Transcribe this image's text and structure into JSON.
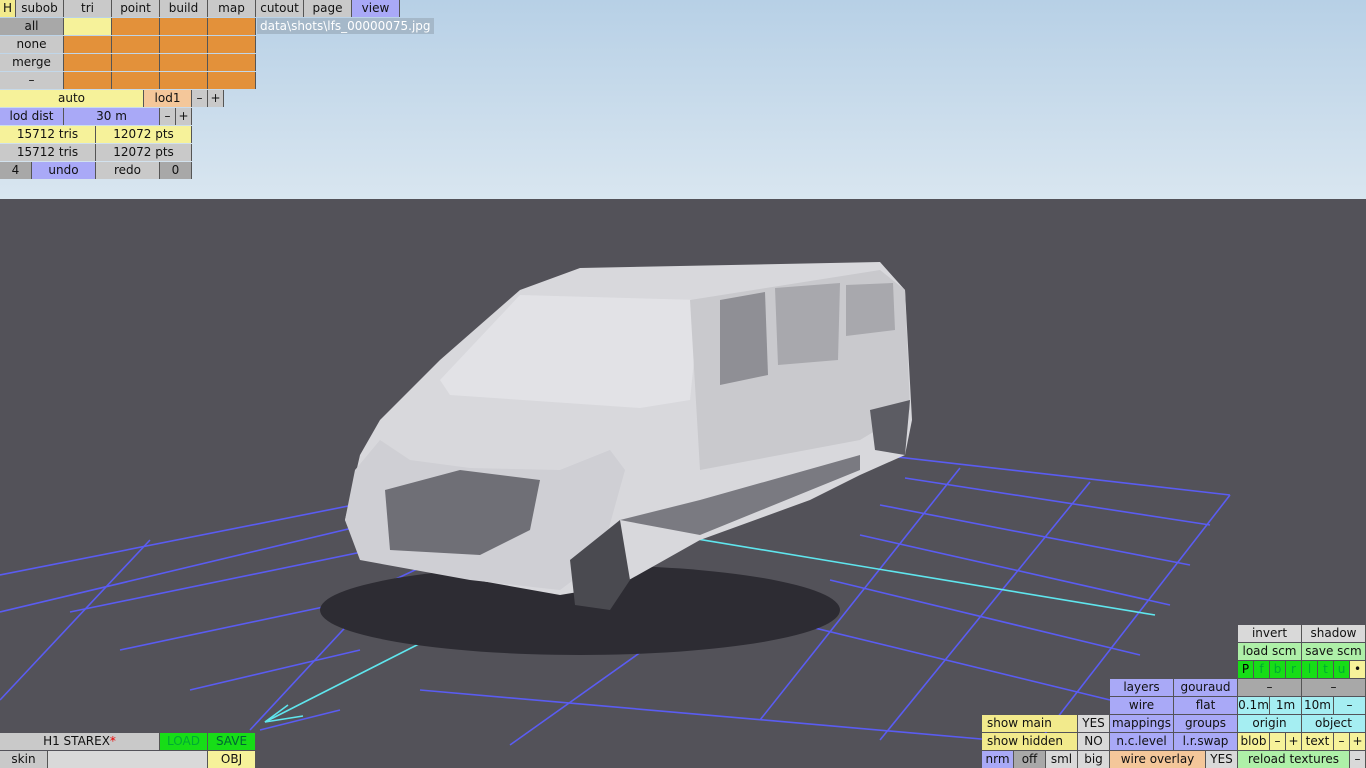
{
  "toolbar": {
    "h": "H",
    "subob": "subob",
    "tri": "tri",
    "point": "point",
    "build": "build",
    "map": "map",
    "cutout": "cutout",
    "page": "page",
    "view": "view"
  },
  "select": {
    "all": "all",
    "none": "none",
    "merge": "merge",
    "dash": "–"
  },
  "file_path": "data\\shots\\lfs_00000075.jpg",
  "lod": {
    "auto": "auto",
    "lod1": "lod1",
    "minus": "–",
    "plus": "+",
    "dist_label": "lod dist",
    "dist_value": "30 m",
    "tris1": "15712 tris",
    "pts1": "12072 pts",
    "tris2": "15712 tris",
    "pts2": "12072 pts"
  },
  "history": {
    "count": "4",
    "undo": "undo",
    "redo": "redo",
    "redo_count": "0"
  },
  "bottom_left": {
    "model_name": "H1 STAREX",
    "modified_mark": "*",
    "load": "LOAD",
    "save": "SAVE",
    "skin": "skin",
    "obj": "OBJ"
  },
  "bottom_right": {
    "invert": "invert",
    "shadow": "shadow",
    "load_scm": "load scm",
    "save_scm": "save scm",
    "view_letters": [
      "P",
      "f",
      "b",
      "r",
      "l",
      "t",
      "u",
      "•"
    ],
    "layers": "layers",
    "gouraud": "gouraud",
    "dash": "–",
    "wire": "wire",
    "flat": "flat",
    "m01": "0.1m",
    "m1": "1m",
    "m10": "10m",
    "show_main": "show main",
    "yes": "YES",
    "mappings": "mappings",
    "groups": "groups",
    "origin": "origin",
    "object": "object",
    "show_hidden": "show hidden",
    "no": "NO",
    "nclevel": "n.c.level",
    "lrswap": "l.r.swap",
    "blob": "blob",
    "text": "text",
    "minus": "–",
    "plus": "+",
    "nrm": "nrm",
    "off": "off",
    "sml": "sml",
    "big": "big",
    "wire_overlay": "wire overlay",
    "reload_textures": "reload textures"
  },
  "colors": {
    "grid": "#5a5cf2",
    "axis": "#5fe6ee",
    "sky": "#c8dcec",
    "ground": "#535259"
  }
}
